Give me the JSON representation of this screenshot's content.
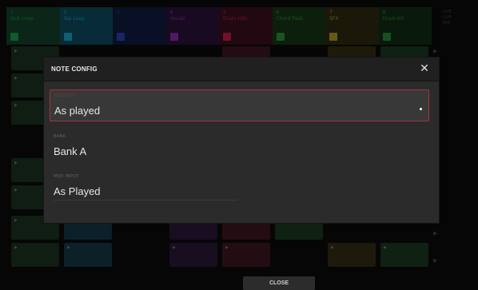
{
  "tracks": [
    {
      "label": "1\nKick Loop",
      "bg": "#14412a",
      "badge": "#1f9b4e"
    },
    {
      "label": "2\nTop Loop",
      "bg": "#0d4a5f",
      "badge": "#1aa4c9"
    },
    {
      "label": "3",
      "bg": "#101a3e",
      "badge": "#2b3fb7"
    },
    {
      "label": "4\nVocals",
      "bg": "#2a1238",
      "badge": "#8c2ab0"
    },
    {
      "label": "5\nDrum Hits",
      "bg": "#3b0f1c",
      "badge": "#c0214d"
    },
    {
      "label": "6\nChord Pads",
      "bg": "#153618",
      "badge": "#2f8f3a"
    },
    {
      "label": "7\nSFX",
      "bg": "#2e2a10",
      "badge": "#b39a2a"
    },
    {
      "label": "8\nDrum Kit",
      "bg": "#112e16",
      "badge": "#2a8a3a"
    }
  ],
  "sidebar_top": "LIVE\nCLIP\nMIX",
  "modal": {
    "title": "NOTE CONFIG",
    "fields": {
      "velocity": {
        "label": "VELOCITY",
        "value": "As played"
      },
      "bank": {
        "label": "BANK",
        "value": "Bank A"
      },
      "midi_input": {
        "label": "MIDI INPUT",
        "value": "As Played"
      }
    }
  },
  "close_button": "CLOSE",
  "icons": {
    "close": "close-icon",
    "play": "play-icon",
    "dropdown": "dropdown-indicator-icon"
  },
  "colors": {
    "accent": "#a2333f",
    "modal_bg": "#2b2b2b",
    "header_bg": "#202020"
  }
}
